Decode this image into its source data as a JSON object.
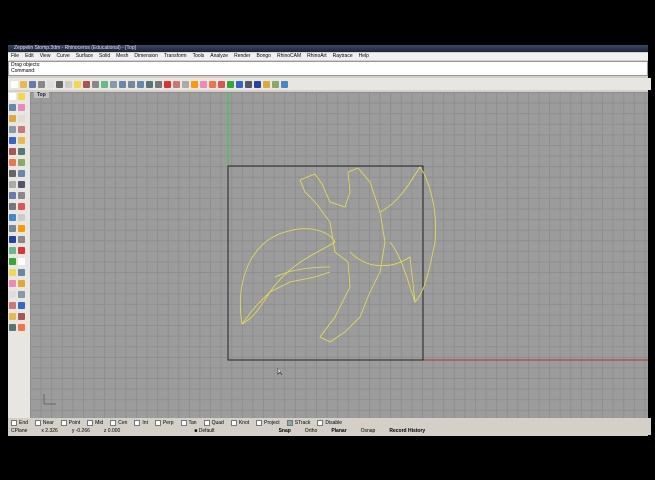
{
  "title": "Zeppelin Stomp.3dm - Rhinoceros (Educational) - [Top]",
  "menu": [
    "File",
    "Edit",
    "View",
    "Curve",
    "Surface",
    "Solid",
    "Mesh",
    "Dimension",
    "Transform",
    "Tools",
    "Analyze",
    "Render",
    "Bongo",
    "RhinoCAM",
    "RhinoArt",
    "Raytrace",
    "Help"
  ],
  "command": {
    "history": "Drag objects:",
    "prompt": "Command:"
  },
  "viewport": {
    "label": "Top"
  },
  "osnaps": [
    {
      "label": "End",
      "on": false
    },
    {
      "label": "Near",
      "on": false
    },
    {
      "label": "Point",
      "on": false
    },
    {
      "label": "Mid",
      "on": false
    },
    {
      "label": "Cen",
      "on": false
    },
    {
      "label": "Int",
      "on": false
    },
    {
      "label": "Perp",
      "on": false
    },
    {
      "label": "Tan",
      "on": false
    },
    {
      "label": "Quad",
      "on": false
    },
    {
      "label": "Knot",
      "on": false
    },
    {
      "label": "Project",
      "on": false
    },
    {
      "label": "STrack",
      "on": true
    },
    {
      "label": "Disable",
      "on": false
    }
  ],
  "status": {
    "cplane": "CPlane",
    "x": "x 2.326",
    "y": "y -0.266",
    "z": "z 0.000",
    "layer": "Default",
    "snap": "Snap",
    "ortho": "Ortho",
    "planar": "Planar",
    "osnap": "Osnap",
    "history": "Record History"
  },
  "toolbar_colors": [
    "#fff",
    "#e9b94a",
    "#6a7ab0",
    "#888",
    "#ddd",
    "#666",
    "#ccc",
    "#f3d84a",
    "#a55",
    "#888",
    "#6b8",
    "#89a",
    "#68a",
    "#789",
    "#68a",
    "#577",
    "#777",
    "#d33",
    "#c77",
    "#aaa",
    "#f90",
    "#e8b",
    "#e74",
    "#d55",
    "#3a3",
    "#36c",
    "#556",
    "#24a",
    "#da3",
    "#8a6",
    "#48c"
  ]
}
